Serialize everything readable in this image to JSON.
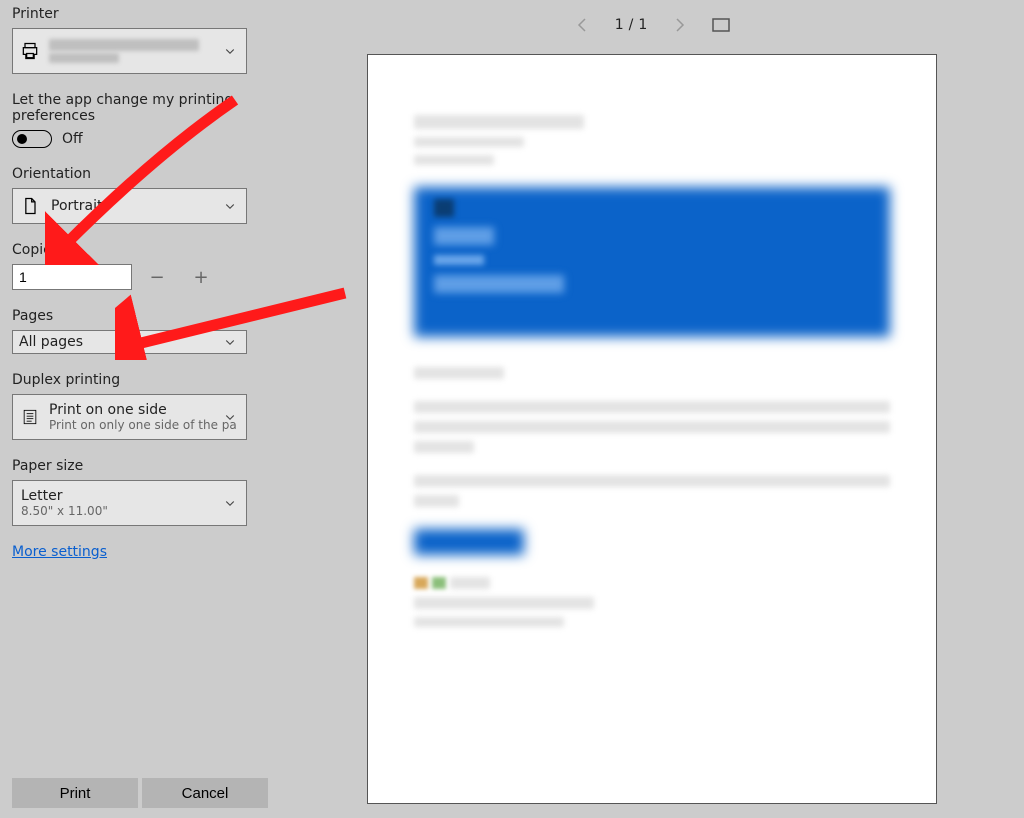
{
  "sections": {
    "printer_label": "Printer",
    "app_pref_label": "Let the app change my printing preferences",
    "toggle_state": "Off",
    "orientation_label": "Orientation",
    "orientation_value": "Portrait",
    "copies_label": "Copies",
    "copies_value": "1",
    "pages_label": "Pages",
    "pages_value": "All pages",
    "duplex_label": "Duplex printing",
    "duplex_value": "Print on one side",
    "duplex_sub": "Print on only one side of the pa",
    "paper_label": "Paper size",
    "paper_value": "Letter",
    "paper_sub": "8.50\" x 11.00\"",
    "more_settings": "More settings"
  },
  "buttons": {
    "print": "Print",
    "cancel": "Cancel"
  },
  "preview": {
    "page_current": "1",
    "page_sep": "/",
    "page_total": "1"
  }
}
